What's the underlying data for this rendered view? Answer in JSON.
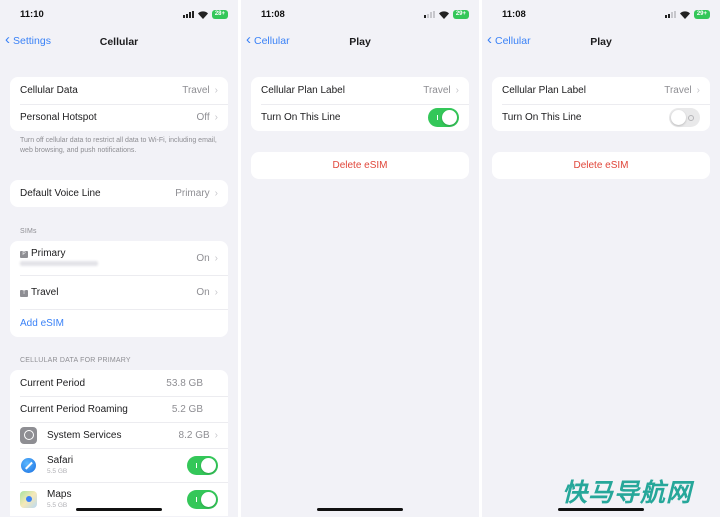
{
  "panels": [
    {
      "status": {
        "time": "11:10",
        "battery": "28+"
      },
      "nav": {
        "back_label": "Settings",
        "title": "Cellular"
      },
      "group1": [
        {
          "label": "Cellular Data",
          "value": "Travel"
        },
        {
          "label": "Personal Hotspot",
          "value": "Off"
        }
      ],
      "group1_footnote": "Turn off cellular data to restrict all data to Wi-Fi, including email, web browsing, and push notifications.",
      "group2": [
        {
          "label": "Default Voice Line",
          "value": "Primary"
        }
      ],
      "sims_header": "SIMs",
      "sims": [
        {
          "tag": "P",
          "label": "Primary",
          "value": "On"
        },
        {
          "tag": "T",
          "label": "Travel",
          "value": "On"
        }
      ],
      "add_esim": "Add eSIM",
      "usage_header": "CELLULAR DATA FOR PRIMARY",
      "usage": [
        {
          "label": "Current Period",
          "value": "53.8 GB"
        },
        {
          "label": "Current Period Roaming",
          "value": "5.2 GB"
        }
      ],
      "apps": [
        {
          "icon": "system-services-icon",
          "label": "System Services",
          "value": "8.2 GB"
        },
        {
          "icon": "safari-icon",
          "label": "Safari",
          "sub": "5.5 GB",
          "toggle": "on"
        },
        {
          "icon": "maps-icon",
          "label": "Maps",
          "sub": "5.5 GB",
          "toggle": "on"
        }
      ]
    },
    {
      "status": {
        "time": "11:08",
        "battery": "29+"
      },
      "nav": {
        "back_label": "Cellular",
        "title": "Play"
      },
      "rows": [
        {
          "label": "Cellular Plan Label",
          "value": "Travel"
        },
        {
          "label": "Turn On This Line",
          "toggle": "on"
        }
      ],
      "delete_label": "Delete eSIM"
    },
    {
      "status": {
        "time": "11:08",
        "battery": "29+"
      },
      "nav": {
        "back_label": "Cellular",
        "title": "Play"
      },
      "rows": [
        {
          "label": "Cellular Plan Label",
          "value": "Travel"
        },
        {
          "label": "Turn On This Line",
          "toggle": "off"
        }
      ],
      "delete_label": "Delete eSIM"
    }
  ],
  "watermark": "快马导航网",
  "colors": {
    "accent": "#3a82f7",
    "toggle_on": "#34c759",
    "destructive": "#e0463a",
    "background": "#f2f2f7"
  }
}
